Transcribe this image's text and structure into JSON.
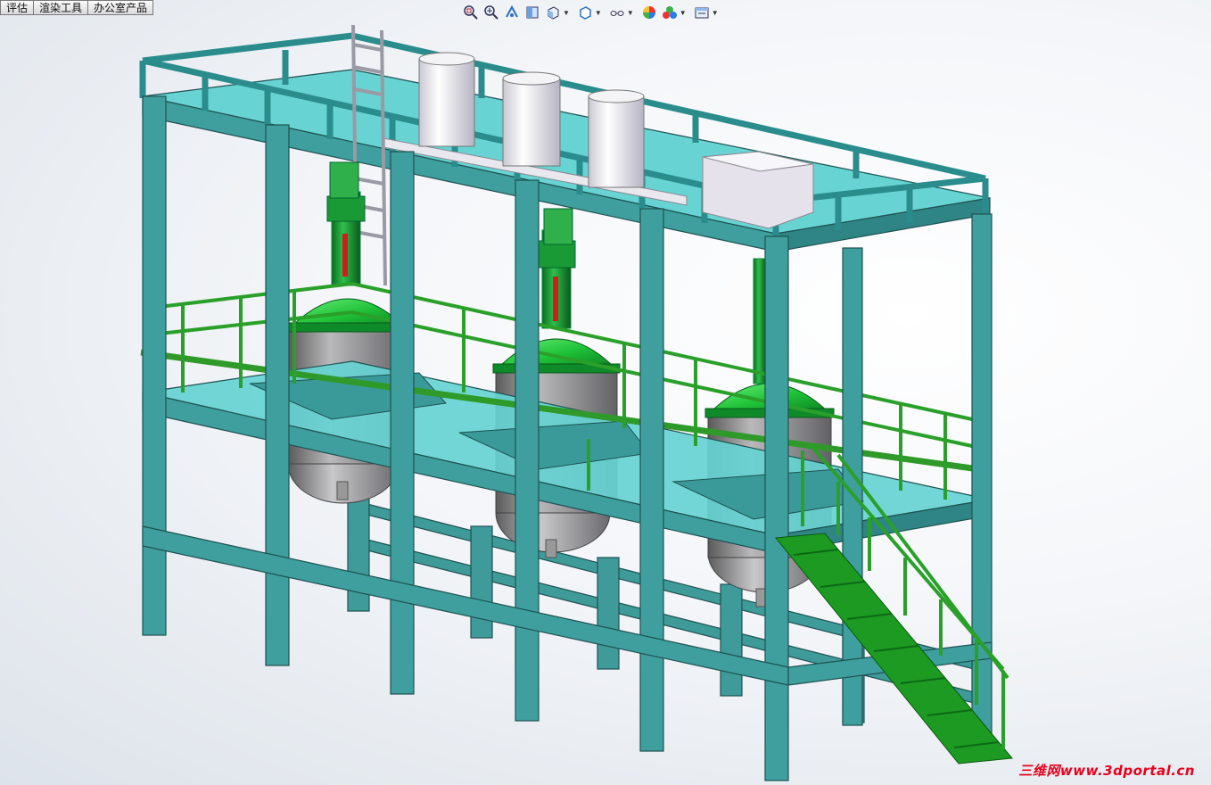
{
  "tabs": [
    {
      "label": "评估"
    },
    {
      "label": "渲染工具"
    },
    {
      "label": "办公室产品"
    }
  ],
  "heads_up_toolbar": [
    {
      "icon": "zoom-to-fit-icon"
    },
    {
      "icon": "zoom-to-area-icon"
    },
    {
      "icon": "previous-view-icon"
    },
    {
      "icon": "section-view-icon"
    },
    {
      "icon": "view-orientation-icon",
      "dropdown": true
    },
    {
      "icon": "display-style-icon",
      "dropdown": true
    },
    {
      "icon": "hide-show-items-icon",
      "dropdown": true
    },
    {
      "icon": "edit-appearance-icon"
    },
    {
      "icon": "apply-scene-icon",
      "dropdown": true
    },
    {
      "icon": "view-settings-icon",
      "dropdown": true
    }
  ],
  "watermark": {
    "text": "三维网www.3dportal.cn"
  },
  "colors": {
    "steel_frame": "#3f9e9e",
    "platform_deck": "#66d2d2",
    "railing": "#2aa02a",
    "reactor_dome": "#22c43a",
    "reactor_shell": "#8a8a8a",
    "tank_white": "#ecebf1",
    "watermark": "#e8001c"
  }
}
